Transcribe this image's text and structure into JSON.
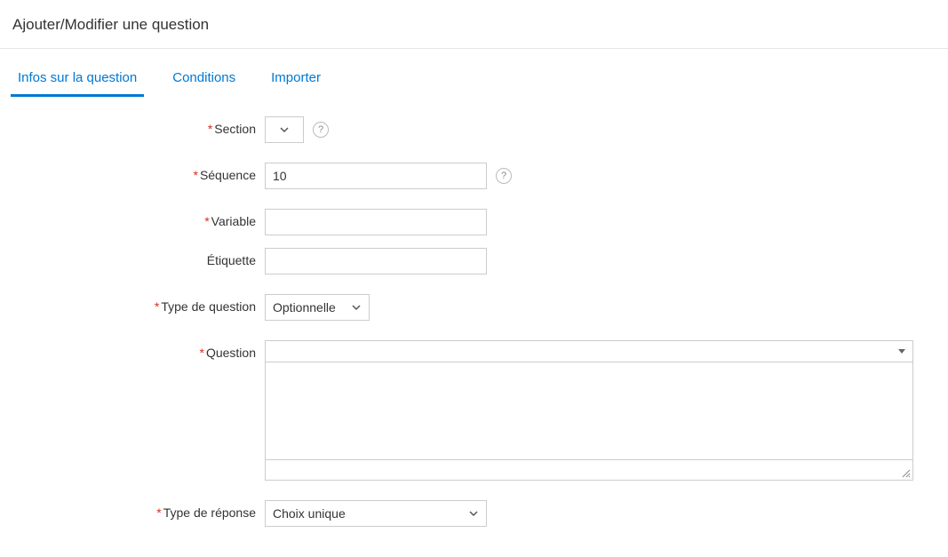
{
  "title": "Ajouter/Modifier une question",
  "tabs": {
    "info": "Infos sur la question",
    "conditions": "Conditions",
    "import": "Importer"
  },
  "labels": {
    "section": "Section",
    "sequence": "Séquence",
    "variable": "Variable",
    "etiquette": "Étiquette",
    "type_question": "Type de question",
    "question": "Question",
    "type_reponse": "Type de réponse"
  },
  "values": {
    "sequence": "10",
    "variable": "",
    "etiquette": "",
    "type_question": "Optionnelle",
    "question": "",
    "type_reponse": "Choix unique"
  },
  "glyphs": {
    "help": "?"
  }
}
